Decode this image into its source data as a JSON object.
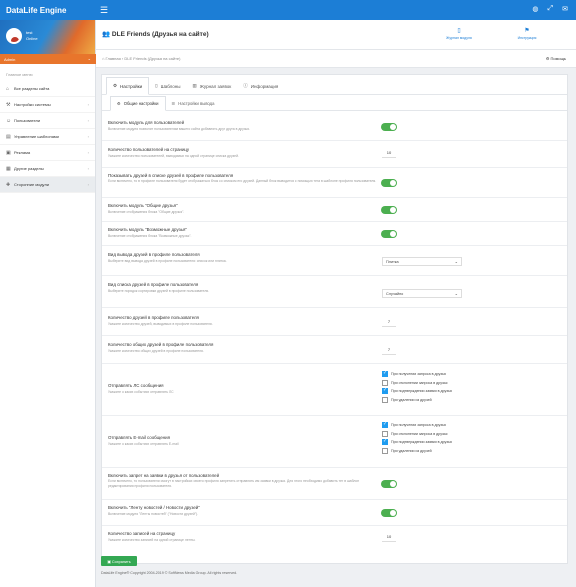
{
  "app": {
    "title": "DataLife Engine"
  },
  "topbar": {
    "icons": [
      "globe-icon",
      "expand-icon",
      "mail-icon"
    ]
  },
  "profile": {
    "name": "test",
    "status": "Online",
    "role": "Admin"
  },
  "nav": {
    "heading": "Главное меню",
    "items": [
      {
        "label": "Все разделы сайта",
        "icon": "home-icon"
      },
      {
        "label": "Настройки системы",
        "icon": "wrench-icon"
      },
      {
        "label": "Пользователи",
        "icon": "users-icon"
      },
      {
        "label": "Управление шаблонами",
        "icon": "template-icon"
      },
      {
        "label": "Реклама",
        "icon": "ad-icon"
      },
      {
        "label": "Другие разделы",
        "icon": "grid-icon"
      },
      {
        "label": "Сторонние модули",
        "icon": "puzzle-icon"
      }
    ]
  },
  "header": {
    "title": "DLE Friends (Друзья на сайте)",
    "btn1": "Журнал модуля",
    "btn2": "Инструкция"
  },
  "breadcrumbs": {
    "home": "Главная",
    "current": "DLE Friends (Друзья на сайте)",
    "help": "Помощь"
  },
  "tabs": [
    "Настройки",
    "Шаблоны",
    "Журнал заявок",
    "Информация"
  ],
  "subtabs": [
    "Общие настройки",
    "Настройки вывода"
  ],
  "settings": {
    "r1": {
      "title": "Включить модуль для пользователей",
      "desc": "Включение модуля позволит пользователям вашего сайта добавлять друг друга в друзья."
    },
    "r2": {
      "title": "Количество пользователей на страницу",
      "desc": "Укажите количество пользователей, выводимых на одной странице списка друзей.",
      "value": "10"
    },
    "r3": {
      "title": "Показывать друзей в списке друзей в профиле пользователя",
      "desc": "Если включено, то в профиле пользователя будет отображаться блок со списком его друзей. Данный блок выводится с помощью тега в шаблоне профиля пользователя."
    },
    "r4": {
      "title": "Включить модуль \"Общие друзья\"",
      "desc": "Включение отображения блока \"Общие друзья\"."
    },
    "r5": {
      "title": "Включить модуль \"Возможные друзья\"",
      "desc": "Включение отображения блока \"Возможные друзья\"."
    },
    "r6": {
      "title": "Вид вывода друзей в профиле пользователя",
      "desc": "Выберите вид вывода друзей в профиле пользователя: список или плитка.",
      "value": "Плитка"
    },
    "r7": {
      "title": "Вид списка друзей в профиле пользователя",
      "desc": "Выберите порядок сортировки друзей в профиле пользователя.",
      "value": "Случайно"
    },
    "r8": {
      "title": "Количество друзей в профиле пользователя",
      "desc": "Укажите количество друзей, выводимых в профиле пользователя.",
      "value": "7"
    },
    "r9": {
      "title": "Количество общих друзей в профиле пользователя",
      "desc": "Укажите количество общих друзей в профиле пользователя.",
      "value": "7"
    },
    "r10": {
      "title": "Отправлять ЛС сообщения",
      "desc": "Укажите о каких событиях отправлять ЛС",
      "options": [
        {
          "label": "При получении запроса в друзья",
          "checked": true
        },
        {
          "label": "При отклонении запроса в друзья",
          "checked": false
        },
        {
          "label": "При подтверждении заявки в друзья",
          "checked": true
        },
        {
          "label": "При удалении из друзей",
          "checked": false
        }
      ]
    },
    "r11": {
      "title": "Отправлять E-mail сообщения",
      "desc": "Укажите о каких событиях отправлять E-mail",
      "options": [
        {
          "label": "При получении запроса в друзья",
          "checked": true
        },
        {
          "label": "При отклонении запроса в друзья",
          "checked": false
        },
        {
          "label": "При подтверждении заявки в друзья",
          "checked": true
        },
        {
          "label": "При удалении из друзей",
          "checked": false
        }
      ]
    },
    "r12": {
      "title": "Включить запрет на заявки в друзья от пользователей",
      "desc": "Если включено, то пользователи смогут в настройках своего профиля запретить отправлять им заявки в друзья. Для этого необходимо добавить тег в шаблон редактирования профиля пользователя."
    },
    "r13": {
      "title": "Включить \"Ленту новостей / Новости друзей\"",
      "desc": "Включение модуля \"Ленты новостей\" (\"Новости друзей\")."
    },
    "r14": {
      "title": "Количество записей на страницу",
      "desc": "Укажите количество записей на одной странице ленты.",
      "value": "10"
    }
  },
  "save_label": "Сохранить",
  "footer": "DataLife Engine® Copyright 2004-2019 © SoftNews Media Group. All rights reserved."
}
